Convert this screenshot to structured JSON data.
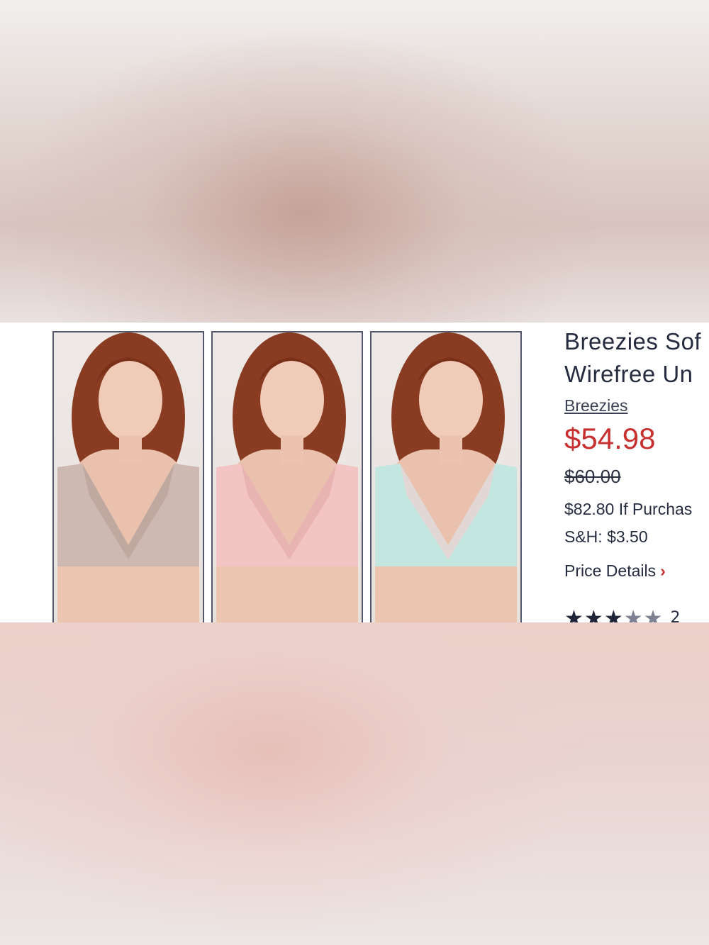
{
  "product": {
    "title_line1": "Breezies Sof",
    "title_line2": "Wirefree Un",
    "brand": "Breezies",
    "price": "$54.98",
    "original_price": "$60.00",
    "easy_pay": "$82.80 If Purchas",
    "shipping": "S&H: $3.50",
    "price_details_label": "Price Details",
    "rating": 2.5,
    "rating_max": 5,
    "review_count": "2"
  },
  "photos": [
    {
      "label": "taupe",
      "bra_color": "#cdb9b1",
      "lace_color": "#bfa8a0"
    },
    {
      "label": "pink",
      "bra_color": "#f2c4c3",
      "lace_color": "#e9b3b2"
    },
    {
      "label": "mint",
      "bra_color": "#c4e6e0",
      "lace_color": "#e2d7d5"
    }
  ],
  "colors": {
    "accent_price": "#c8302f",
    "text": "#262c3f"
  }
}
